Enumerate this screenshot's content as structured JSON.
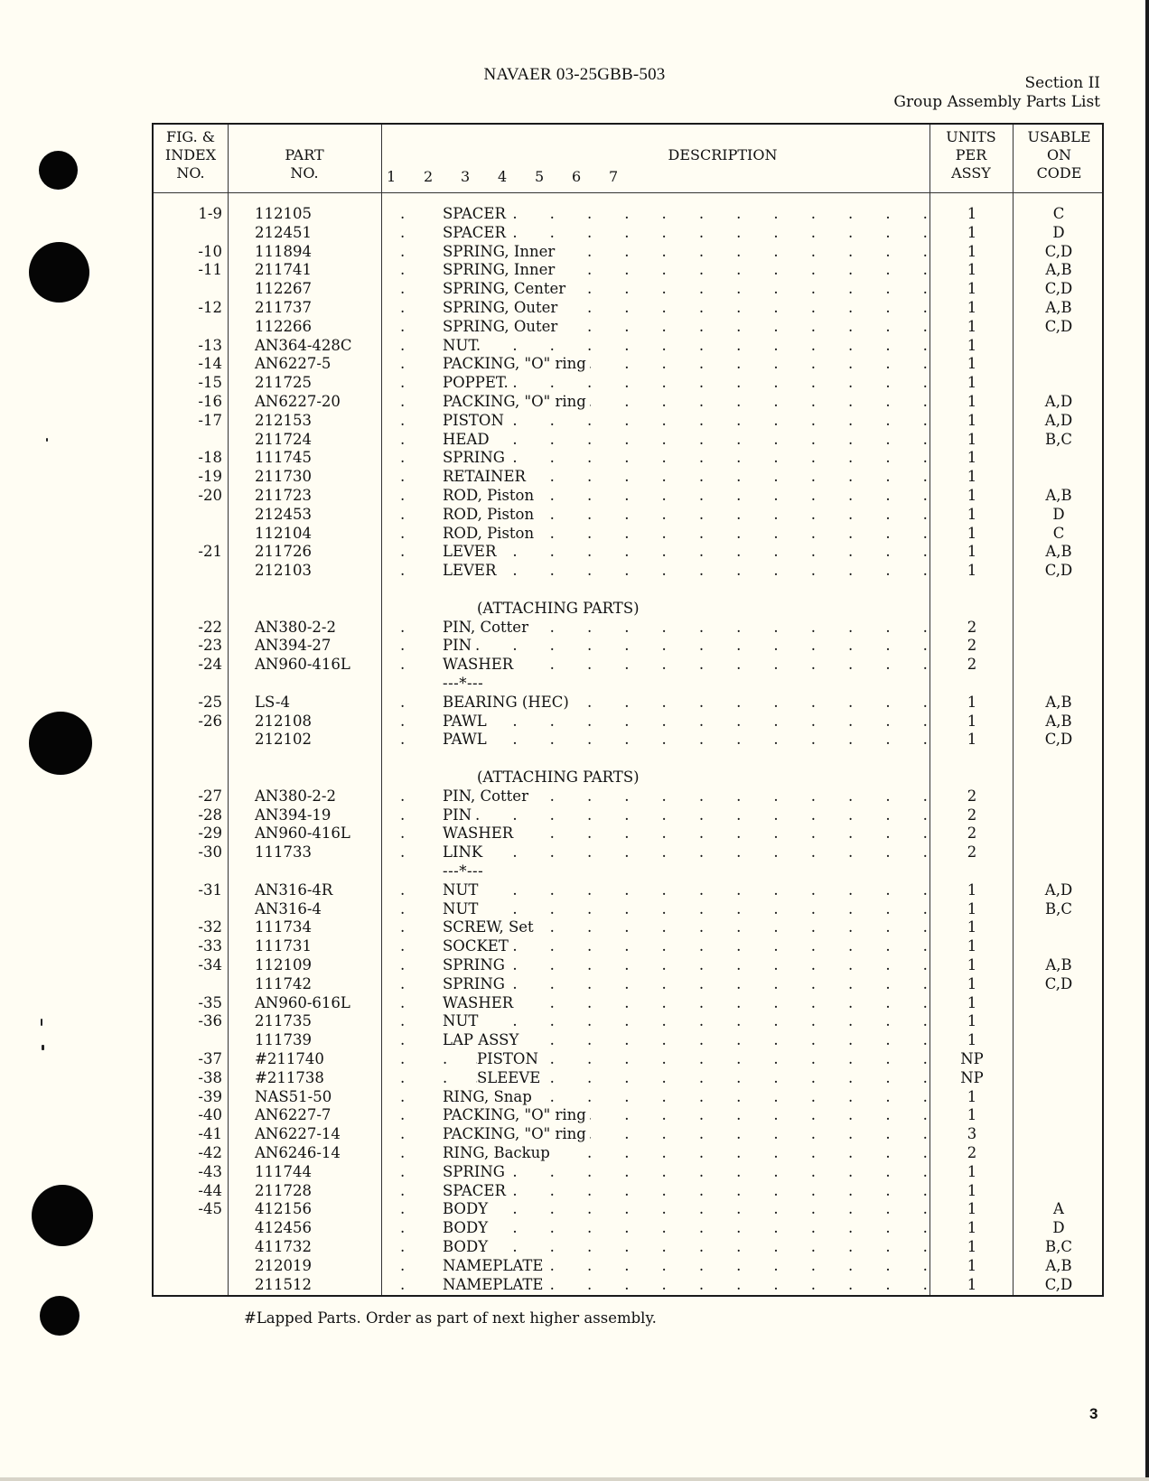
{
  "header": {
    "doc_id": "NAVAER 03-25GBB-503",
    "section": "Section II",
    "section_title": "Group Assembly Parts List"
  },
  "columns": {
    "index": [
      "FIG. &",
      "INDEX",
      "NO."
    ],
    "part": [
      "PART",
      "NO."
    ],
    "description": "DESCRIPTION",
    "levels": [
      "1",
      "2",
      "3",
      "4",
      "5",
      "6",
      "7"
    ],
    "units": [
      "UNITS",
      "PER",
      "ASSY"
    ],
    "code": [
      "USABLE",
      "ON",
      "CODE"
    ]
  },
  "rows": [
    {
      "type": "item",
      "index": "1-9",
      "part": "112105",
      "desc": "SPACER",
      "units": "1",
      "code": "C"
    },
    {
      "type": "item",
      "index": "",
      "part": "212451",
      "desc": "SPACER",
      "units": "1",
      "code": "D"
    },
    {
      "type": "item",
      "index": "-10",
      "part": "111894",
      "desc": "SPRING, Inner",
      "units": "1",
      "code": "C,D"
    },
    {
      "type": "item",
      "index": "-11",
      "part": "211741",
      "desc": "SPRING, Inner",
      "units": "1",
      "code": "A,B"
    },
    {
      "type": "item",
      "index": "",
      "part": "112267",
      "desc": "SPRING, Center",
      "units": "1",
      "code": "C,D"
    },
    {
      "type": "item",
      "index": "-12",
      "part": "211737",
      "desc": "SPRING, Outer",
      "units": "1",
      "code": "A,B"
    },
    {
      "type": "item",
      "index": "",
      "part": "112266",
      "desc": "SPRING, Outer",
      "units": "1",
      "code": "C,D"
    },
    {
      "type": "item",
      "index": "-13",
      "part": "AN364-428C",
      "desc": "NUT.",
      "units": "1",
      "code": ""
    },
    {
      "type": "item",
      "index": "-14",
      "part": "AN6227-5",
      "desc": "PACKING, \"O\" ring",
      "units": "1",
      "code": ""
    },
    {
      "type": "item",
      "index": "-15",
      "part": "211725",
      "desc": "POPPET.",
      "units": "1",
      "code": ""
    },
    {
      "type": "item",
      "index": "-16",
      "part": "AN6227-20",
      "desc": "PACKING, \"O\" ring",
      "units": "1",
      "code": "A,D"
    },
    {
      "type": "item",
      "index": "-17",
      "part": "212153",
      "desc": "PISTON",
      "units": "1",
      "code": "A,D"
    },
    {
      "type": "item",
      "index": "",
      "part": "211724",
      "desc": "HEAD",
      "units": "1",
      "code": "B,C"
    },
    {
      "type": "item",
      "index": "-18",
      "part": "111745",
      "desc": "SPRING",
      "units": "1",
      "code": ""
    },
    {
      "type": "item",
      "index": "-19",
      "part": "211730",
      "desc": "RETAINER",
      "units": "1",
      "code": ""
    },
    {
      "type": "item",
      "index": "-20",
      "part": "211723",
      "desc": "ROD, Piston",
      "units": "1",
      "code": "A,B"
    },
    {
      "type": "item",
      "index": "",
      "part": "212453",
      "desc": "ROD, Piston",
      "units": "1",
      "code": "D"
    },
    {
      "type": "item",
      "index": "",
      "part": "112104",
      "desc": "ROD, Piston",
      "units": "1",
      "code": "C"
    },
    {
      "type": "item",
      "index": "-21",
      "part": "211726",
      "desc": "LEVER",
      "units": "1",
      "code": "A,B"
    },
    {
      "type": "item",
      "index": "",
      "part": "212103",
      "desc": "LEVER",
      "units": "1",
      "code": "C,D"
    },
    {
      "type": "blank"
    },
    {
      "type": "heading",
      "text": "(ATTACHING PARTS)"
    },
    {
      "type": "item",
      "index": "-22",
      "part": "AN380-2-2",
      "desc": "PIN, Cotter",
      "units": "2",
      "code": ""
    },
    {
      "type": "item",
      "index": "-23",
      "part": "AN394-27",
      "desc": "PIN",
      "units": "2",
      "code": ""
    },
    {
      "type": "item",
      "index": "-24",
      "part": "AN960-416L",
      "desc": "WASHER",
      "units": "2",
      "code": ""
    },
    {
      "type": "separator",
      "text": "---*---"
    },
    {
      "type": "item",
      "index": "-25",
      "part": "LS-4",
      "desc": "BEARING (HEC)",
      "units": "1",
      "code": "A,B"
    },
    {
      "type": "item",
      "index": "-26",
      "part": "212108",
      "desc": "PAWL",
      "units": "1",
      "code": "A,B"
    },
    {
      "type": "item",
      "index": "",
      "part": "212102",
      "desc": "PAWL",
      "units": "1",
      "code": "C,D"
    },
    {
      "type": "blank"
    },
    {
      "type": "heading",
      "text": "(ATTACHING PARTS)"
    },
    {
      "type": "item",
      "index": "-27",
      "part": "AN380-2-2",
      "desc": "PIN, Cotter",
      "units": "2",
      "code": ""
    },
    {
      "type": "item",
      "index": "-28",
      "part": "AN394-19",
      "desc": "PIN",
      "units": "2",
      "code": ""
    },
    {
      "type": "item",
      "index": "-29",
      "part": "AN960-416L",
      "desc": "WASHER",
      "units": "2",
      "code": ""
    },
    {
      "type": "item",
      "index": "-30",
      "part": "111733",
      "desc": "LINK",
      "units": "2",
      "code": ""
    },
    {
      "type": "separator",
      "text": "---*---"
    },
    {
      "type": "item",
      "index": "-31",
      "part": "AN316-4R",
      "desc": "NUT",
      "units": "1",
      "code": "A,D"
    },
    {
      "type": "item",
      "index": "",
      "part": "AN316-4",
      "desc": "NUT",
      "units": "1",
      "code": "B,C"
    },
    {
      "type": "item",
      "index": "-32",
      "part": "111734",
      "desc": "SCREW, Set",
      "units": "1",
      "code": ""
    },
    {
      "type": "item",
      "index": "-33",
      "part": "111731",
      "desc": "SOCKET",
      "units": "1",
      "code": ""
    },
    {
      "type": "item",
      "index": "-34",
      "part": "112109",
      "desc": "SPRING",
      "units": "1",
      "code": "A,B"
    },
    {
      "type": "item",
      "index": "",
      "part": "111742",
      "desc": "SPRING",
      "units": "1",
      "code": "C,D"
    },
    {
      "type": "item",
      "index": "-35",
      "part": "AN960-616L",
      "desc": "WASHER",
      "units": "1",
      "code": ""
    },
    {
      "type": "item",
      "index": "-36",
      "part": "211735",
      "desc": "NUT",
      "units": "1",
      "code": ""
    },
    {
      "type": "item",
      "index": "",
      "part": "111739",
      "desc": "LAP ASSY",
      "units": "1",
      "code": ""
    },
    {
      "type": "item",
      "index": "-37",
      "part": "#211740",
      "desc": "PISTON",
      "level": 2,
      "units": "NP",
      "code": ""
    },
    {
      "type": "item",
      "index": "-38",
      "part": "#211738",
      "desc": "SLEEVE",
      "level": 2,
      "units": "NP",
      "code": ""
    },
    {
      "type": "item",
      "index": "-39",
      "part": "NAS51-50",
      "desc": "RING, Snap",
      "units": "1",
      "code": ""
    },
    {
      "type": "item",
      "index": "-40",
      "part": "AN6227-7",
      "desc": "PACKING, \"O\" ring",
      "units": "1",
      "code": ""
    },
    {
      "type": "item",
      "index": "-41",
      "part": "AN6227-14",
      "desc": "PACKING, \"O\" ring",
      "units": "3",
      "code": ""
    },
    {
      "type": "item",
      "index": "-42",
      "part": "AN6246-14",
      "desc": "RING, Backup",
      "units": "2",
      "code": ""
    },
    {
      "type": "item",
      "index": "-43",
      "part": "111744",
      "desc": "SPRING",
      "units": "1",
      "code": ""
    },
    {
      "type": "item",
      "index": "-44",
      "part": "211728",
      "desc": "SPACER",
      "units": "1",
      "code": ""
    },
    {
      "type": "item",
      "index": "-45",
      "part": "412156",
      "desc": "BODY",
      "units": "1",
      "code": "A"
    },
    {
      "type": "item",
      "index": "",
      "part": "412456",
      "desc": "BODY",
      "units": "1",
      "code": "D"
    },
    {
      "type": "item",
      "index": "",
      "part": "411732",
      "desc": "BODY",
      "units": "1",
      "code": "B,C"
    },
    {
      "type": "item",
      "index": "",
      "part": "212019",
      "desc": "NAMEPLATE",
      "units": "1",
      "code": "A,B"
    },
    {
      "type": "item",
      "index": "",
      "part": "211512",
      "desc": "NAMEPLATE",
      "units": "1",
      "code": "C,D"
    }
  ],
  "footnote": "#Lapped Parts.  Order as part of next higher assembly.",
  "page_number": "3"
}
